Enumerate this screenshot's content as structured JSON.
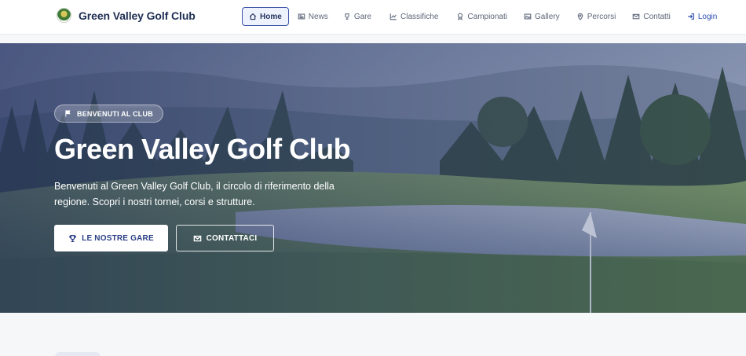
{
  "brand": {
    "name": "Green Valley Golf Club",
    "logo": "club-crest-icon"
  },
  "nav": {
    "items": [
      {
        "label": "Home",
        "icon": "home-icon",
        "active": true
      },
      {
        "label": "News",
        "icon": "newspaper-icon"
      },
      {
        "label": "Gare",
        "icon": "trophy-icon"
      },
      {
        "label": "Classifiche",
        "icon": "chart-line-icon"
      },
      {
        "label": "Campionati",
        "icon": "award-icon"
      },
      {
        "label": "Gallery",
        "icon": "image-icon"
      },
      {
        "label": "Percorsi",
        "icon": "map-pin-icon"
      },
      {
        "label": "Contatti",
        "icon": "envelope-icon"
      }
    ],
    "login": {
      "label": "Login",
      "icon": "login-icon"
    }
  },
  "hero": {
    "badge": "BENVENUTI AL CLUB",
    "badge_icon": "flag-icon",
    "title": "Green Valley Golf Club",
    "text": "Benvenuti al Green Valley Golf Club, il circolo di riferimento della regione. Scopri i nostri tornei, corsi e strutture.",
    "primary_button": "LE NOSTRE GARE",
    "secondary_button": "CONTATTACI"
  },
  "colors": {
    "brand_navy": "#1e2e52",
    "accent_blue": "#3a55a6",
    "hero_overlay": "#202c5c"
  }
}
